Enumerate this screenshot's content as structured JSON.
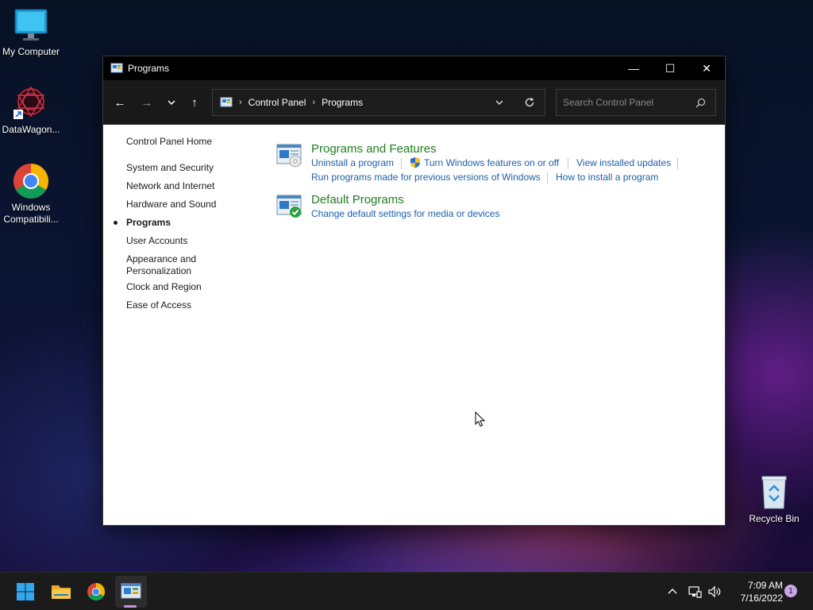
{
  "desktop": {
    "icons": [
      {
        "label": "My Computer",
        "icon": "computer-icon"
      },
      {
        "label": "DataWagon...",
        "icon": "datawagon-icon"
      },
      {
        "label": "Windows Compatibili...",
        "icon": "chrome-icon"
      },
      {
        "label": "Recycle Bin",
        "icon": "recycle-bin-icon"
      }
    ]
  },
  "window": {
    "title": "Programs",
    "controls": {
      "minimize": "—",
      "maximize": "☐",
      "close": "✕"
    },
    "nav": {
      "back": "←",
      "forward": "→",
      "recent": "⌄",
      "up": "↑"
    },
    "path": [
      "Control Panel",
      "Programs"
    ],
    "search": {
      "placeholder": "Search Control Panel"
    }
  },
  "left_nav": {
    "items": [
      {
        "label": "Control Panel Home"
      },
      {
        "label": "System and Security"
      },
      {
        "label": "Network and Internet"
      },
      {
        "label": "Hardware and Sound"
      },
      {
        "label": "Programs",
        "current": true
      },
      {
        "label": "User Accounts"
      },
      {
        "label": "Appearance and"
      },
      {
        "label": "Personalization"
      },
      {
        "label": "Clock and Region"
      },
      {
        "label": "Ease of Access"
      }
    ]
  },
  "categories": [
    {
      "title": "Programs and Features",
      "icon": "programs-features-icon",
      "links": [
        "Uninstall a program",
        "Turn Windows features on or off",
        "View installed updates",
        "Run programs made for previous versions of Windows",
        "How to install a program"
      ]
    },
    {
      "title": "Default Programs",
      "icon": "default-programs-icon",
      "links": [
        "Change default settings for media or devices"
      ]
    }
  ],
  "taskbar": {
    "apps": [
      "start-icon",
      "file-explorer-icon",
      "chrome-icon",
      "control-panel-icon"
    ],
    "clock": {
      "time": "7:09 AM",
      "date": "7/16/2022"
    },
    "notification_count": "1"
  },
  "colors": {
    "link": "#1d5fa8",
    "category_title": "#1e7d1e",
    "titlebar": "#000000",
    "taskbar": "#1b1b1b"
  }
}
